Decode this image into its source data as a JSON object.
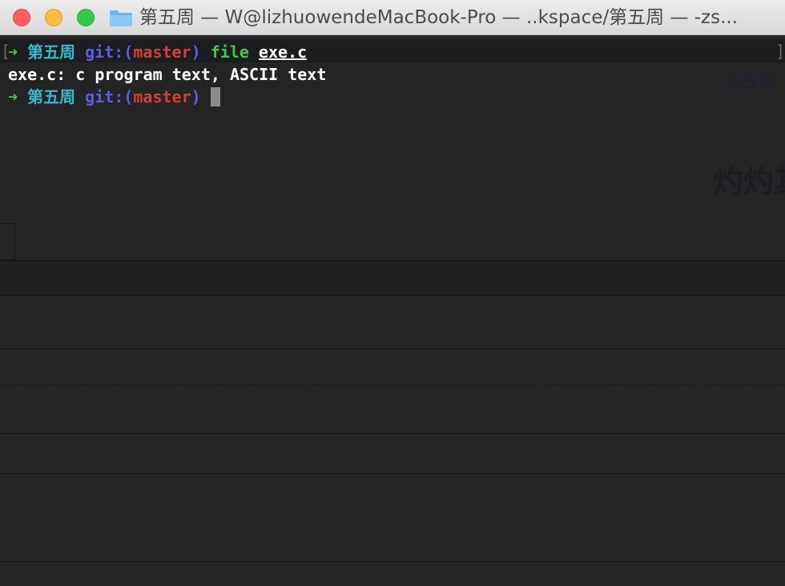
{
  "window": {
    "title": "第五周 — W@lizhuowendeMacBook-Pro — ..kspace/第五周 — -zs..."
  },
  "terminal": {
    "line1": {
      "arrow": "➜",
      "dir": "第五周",
      "git_prefix": "git:(",
      "branch": "master",
      "git_suffix": ")",
      "command": "file",
      "argument": "exe.c"
    },
    "line2": {
      "output": "exe.c: c program text, ASCII text"
    },
    "line3": {
      "arrow": "➜",
      "dir": "第五周",
      "git_prefix": "git:(",
      "branch": "master",
      "git_suffix": ")"
    },
    "bracket_left": "[",
    "bracket_right": "]"
  },
  "background_page": {
    "small_text": "修改密",
    "big_text": "灼灼其"
  },
  "colors": {
    "prompt_arrow": "#3fc74d",
    "directory": "#39b8c8",
    "git": "#5b5ee0",
    "branch": "#d63e3a",
    "command": "#3fc74d"
  },
  "icons": {
    "folder": "folder-icon"
  }
}
